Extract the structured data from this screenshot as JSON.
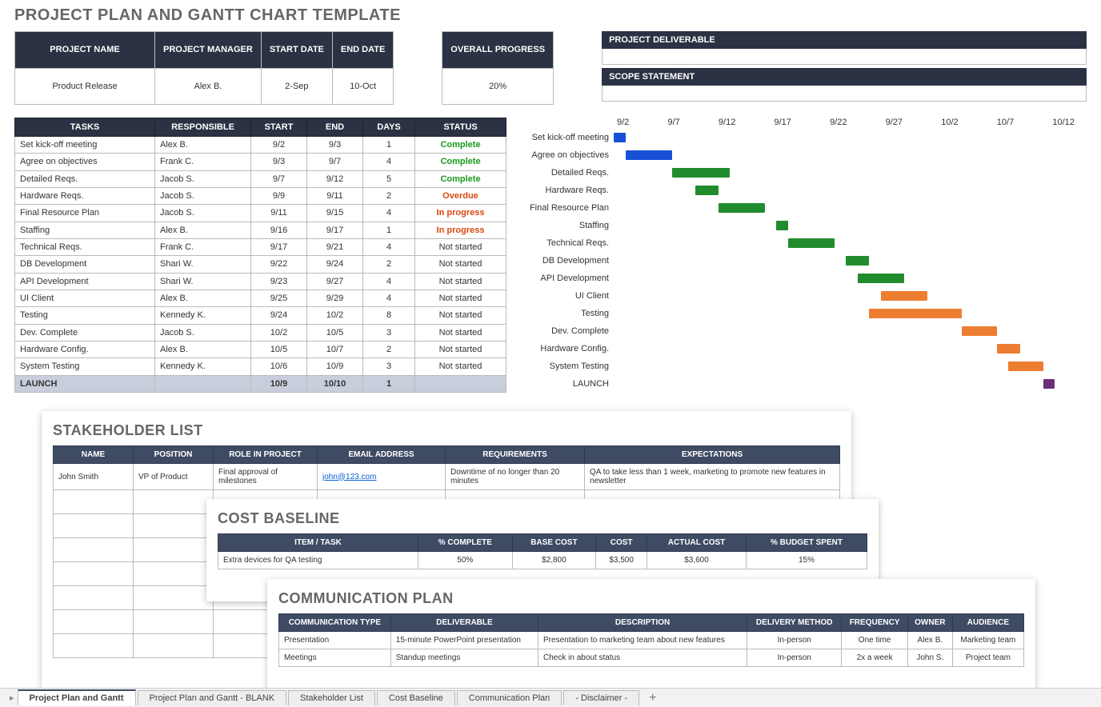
{
  "pageTitle": "PROJECT PLAN AND GANTT CHART TEMPLATE",
  "meta": {
    "headers": {
      "pname": "PROJECT NAME",
      "pmgr": "PROJECT MANAGER",
      "sdate": "START DATE",
      "edate": "END DATE"
    },
    "values": {
      "pname": "Product Release",
      "pmgr": "Alex B.",
      "sdate": "2-Sep",
      "edate": "10-Oct"
    }
  },
  "progress": {
    "header": "OVERALL PROGRESS",
    "value": "20%"
  },
  "deliverable": {
    "header": "PROJECT DELIVERABLE"
  },
  "scope": {
    "header": "SCOPE STATEMENT"
  },
  "taskHeaders": {
    "task": "TASKS",
    "resp": "RESPONSIBLE",
    "start": "START",
    "end": "END",
    "days": "DAYS",
    "status": "STATUS"
  },
  "tasks": [
    {
      "task": "Set kick-off meeting",
      "resp": "Alex B.",
      "start": "9/2",
      "end": "9/3",
      "days": "1",
      "status": "Complete",
      "cls": "status-complete"
    },
    {
      "task": "Agree on objectives",
      "resp": "Frank C.",
      "start": "9/3",
      "end": "9/7",
      "days": "4",
      "status": "Complete",
      "cls": "status-complete"
    },
    {
      "task": "Detailed Reqs.",
      "resp": "Jacob S.",
      "start": "9/7",
      "end": "9/12",
      "days": "5",
      "status": "Complete",
      "cls": "status-complete"
    },
    {
      "task": "Hardware Reqs.",
      "resp": "Jacob S.",
      "start": "9/9",
      "end": "9/11",
      "days": "2",
      "status": "Overdue",
      "cls": "status-overdue"
    },
    {
      "task": "Final Resource Plan",
      "resp": "Jacob S.",
      "start": "9/11",
      "end": "9/15",
      "days": "4",
      "status": "In progress",
      "cls": "status-progress"
    },
    {
      "task": "Staffing",
      "resp": "Alex B.",
      "start": "9/16",
      "end": "9/17",
      "days": "1",
      "status": "In progress",
      "cls": "status-progress"
    },
    {
      "task": "Technical Reqs.",
      "resp": "Frank C.",
      "start": "9/17",
      "end": "9/21",
      "days": "4",
      "status": "Not started",
      "cls": ""
    },
    {
      "task": "DB Development",
      "resp": "Shari W.",
      "start": "9/22",
      "end": "9/24",
      "days": "2",
      "status": "Not started",
      "cls": ""
    },
    {
      "task": "API Development",
      "resp": "Shari W.",
      "start": "9/23",
      "end": "9/27",
      "days": "4",
      "status": "Not started",
      "cls": ""
    },
    {
      "task": "UI Client",
      "resp": "Alex B.",
      "start": "9/25",
      "end": "9/29",
      "days": "4",
      "status": "Not started",
      "cls": ""
    },
    {
      "task": "Testing",
      "resp": "Kennedy K.",
      "start": "9/24",
      "end": "10/2",
      "days": "8",
      "status": "Not started",
      "cls": ""
    },
    {
      "task": "Dev. Complete",
      "resp": "Jacob S.",
      "start": "10/2",
      "end": "10/5",
      "days": "3",
      "status": "Not started",
      "cls": ""
    },
    {
      "task": "Hardware Config.",
      "resp": "Alex B.",
      "start": "10/5",
      "end": "10/7",
      "days": "2",
      "status": "Not started",
      "cls": ""
    },
    {
      "task": "System Testing",
      "resp": "Kennedy K.",
      "start": "10/6",
      "end": "10/9",
      "days": "3",
      "status": "Not started",
      "cls": ""
    },
    {
      "task": "LAUNCH",
      "resp": "",
      "start": "10/9",
      "end": "10/10",
      "days": "1",
      "status": "",
      "cls": "",
      "rowcls": "launch"
    }
  ],
  "chart_data": {
    "type": "bar",
    "xlabel": "",
    "ylabel": "",
    "x_range": [
      "9/2",
      "10/12"
    ],
    "ticks": [
      "9/2",
      "9/7",
      "9/12",
      "9/17",
      "9/22",
      "9/27",
      "10/2",
      "10/7",
      "10/12"
    ],
    "series": [
      {
        "name": "Set kick-off meeting",
        "start": 0,
        "len": 1,
        "color": "blue"
      },
      {
        "name": "Agree on objectives",
        "start": 1,
        "len": 4,
        "color": "blue"
      },
      {
        "name": "Detailed Reqs.",
        "start": 5,
        "len": 5,
        "color": "green"
      },
      {
        "name": "Hardware Reqs.",
        "start": 7,
        "len": 2,
        "color": "green"
      },
      {
        "name": "Final Resource Plan",
        "start": 9,
        "len": 4,
        "color": "green"
      },
      {
        "name": "Staffing",
        "start": 14,
        "len": 1,
        "color": "green"
      },
      {
        "name": "Technical Reqs.",
        "start": 15,
        "len": 4,
        "color": "green"
      },
      {
        "name": "DB Development",
        "start": 20,
        "len": 2,
        "color": "green"
      },
      {
        "name": "API Development",
        "start": 21,
        "len": 4,
        "color": "green"
      },
      {
        "name": "UI Client",
        "start": 23,
        "len": 4,
        "color": "orange"
      },
      {
        "name": "Testing",
        "start": 22,
        "len": 8,
        "color": "orange"
      },
      {
        "name": "Dev. Complete",
        "start": 30,
        "len": 3,
        "color": "orange"
      },
      {
        "name": "Hardware Config.",
        "start": 33,
        "len": 2,
        "color": "orange"
      },
      {
        "name": "System Testing",
        "start": 34,
        "len": 3,
        "color": "orange"
      },
      {
        "name": "LAUNCH",
        "start": 37,
        "len": 1,
        "color": "purple"
      }
    ],
    "total_days": 40
  },
  "stakeholder": {
    "title": "STAKEHOLDER LIST",
    "headers": {
      "name": "NAME",
      "pos": "POSITION",
      "role": "ROLE IN PROJECT",
      "email": "EMAIL ADDRESS",
      "req": "REQUIREMENTS",
      "exp": "EXPECTATIONS"
    },
    "rows": [
      {
        "name": "John Smith",
        "pos": "VP of Product",
        "role": "Final approval of milestones",
        "email": "john@123.com",
        "req": "Downtime of no longer than 20 minutes",
        "exp": "QA to take less than 1 week, marketing to promote new features in newsletter"
      }
    ]
  },
  "cost": {
    "title": "COST BASELINE",
    "headers": {
      "item": "ITEM / TASK",
      "pct": "% COMPLETE",
      "base": "BASE COST",
      "cost": "COST",
      "actual": "ACTUAL COST",
      "budget": "% BUDGET SPENT"
    },
    "rows": [
      {
        "item": "Extra devices for QA testing",
        "pct": "50%",
        "base": "$2,800",
        "cost": "$3,500",
        "actual": "$3,600",
        "budget": "15%"
      }
    ]
  },
  "comm": {
    "title": "COMMUNICATION PLAN",
    "headers": {
      "type": "COMMUNICATION TYPE",
      "del": "DELIVERABLE",
      "desc": "DESCRIPTION",
      "meth": "DELIVERY METHOD",
      "freq": "FREQUENCY",
      "owner": "OWNER",
      "aud": "AUDIENCE"
    },
    "rows": [
      {
        "type": "Presentation",
        "del": "15-minute PowerPoint presentation",
        "desc": "Presentation to marketing team about new features",
        "meth": "In-person",
        "freq": "One time",
        "owner": "Alex B.",
        "aud": "Marketing team"
      },
      {
        "type": "Meetings",
        "del": "Standup meetings",
        "desc": "Check in about status",
        "meth": "In-person",
        "freq": "2x a week",
        "owner": "John S.",
        "aud": "Project team"
      }
    ]
  },
  "tabs": [
    {
      "label": "Project Plan and Gantt",
      "active": true
    },
    {
      "label": "Project Plan and Gantt - BLANK"
    },
    {
      "label": "Stakeholder List"
    },
    {
      "label": "Cost Baseline"
    },
    {
      "label": "Communication Plan"
    },
    {
      "label": "- Disclaimer -"
    }
  ]
}
